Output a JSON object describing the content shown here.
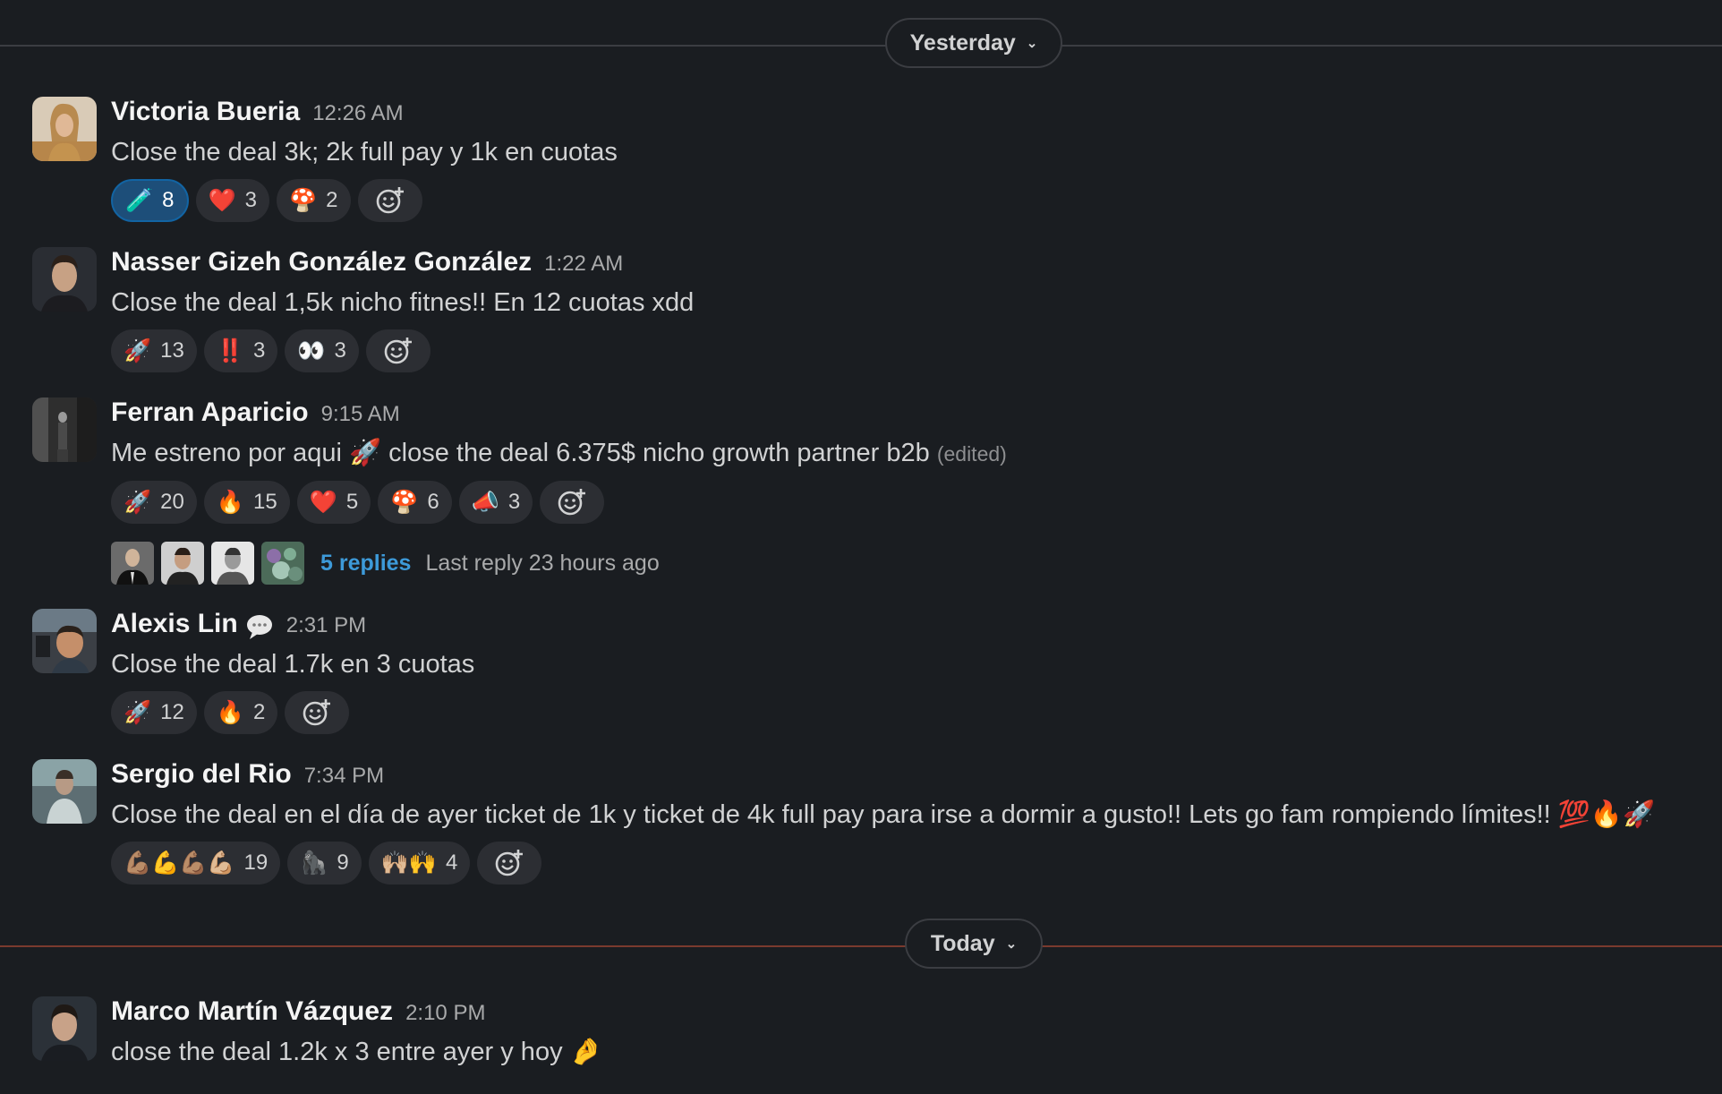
{
  "colors": {
    "background": "#1a1d21",
    "divider_yesterday": "#3b3d42",
    "divider_today": "#7a3a2e",
    "link": "#3d9ad9",
    "active_reaction_bg": "#1d4e79"
  },
  "dividers": {
    "yesterday": {
      "label": "Yesterday"
    },
    "today": {
      "label": "Today"
    }
  },
  "messages": [
    {
      "name": "Victoria Bueria",
      "time": "12:26 AM",
      "text": "Close the deal 3k; 2k full pay y 1k en cuotas",
      "reactions": [
        {
          "emoji": "🧪",
          "icon": "test-tube-icon",
          "count": "8",
          "active": true
        },
        {
          "emoji": "❤️",
          "icon": "heart-icon",
          "count": "3"
        },
        {
          "emoji": "🍄",
          "icon": "mushroom-icon",
          "count": "2"
        }
      ]
    },
    {
      "name": "Nasser Gizeh González González",
      "time": "1:22 AM",
      "text": "Close the deal 1,5k nicho fitnes!! En 12 cuotas xdd",
      "reactions": [
        {
          "emoji": "🚀",
          "icon": "rocket-icon",
          "count": "13"
        },
        {
          "emoji": "‼️",
          "icon": "double-exclamation-icon",
          "count": "3"
        },
        {
          "emoji": "👀",
          "icon": "eyes-icon",
          "count": "3"
        }
      ]
    },
    {
      "name": "Ferran Aparicio",
      "time": "9:15 AM",
      "text_before": "Me estreno por aqui",
      "text_emoji": "🚀",
      "text_after": "close the deal 6.375$ nicho growth partner b2b",
      "edited": "(edited)",
      "reactions": [
        {
          "emoji": "🚀",
          "icon": "rocket-icon",
          "count": "20"
        },
        {
          "emoji": "🔥",
          "icon": "fire-icon",
          "count": "15"
        },
        {
          "emoji": "❤️",
          "icon": "heart-icon",
          "count": "5"
        },
        {
          "emoji": "🍄",
          "icon": "mushroom-icon",
          "count": "6"
        },
        {
          "emoji": "📣",
          "icon": "megaphone-icon",
          "count": "3"
        }
      ],
      "thread": {
        "replies": "5 replies",
        "last_reply": "Last reply 23 hours ago"
      }
    },
    {
      "name": "Alexis Lin",
      "time": "2:31 PM",
      "status_icon": "speech-bubble-icon",
      "text": "Close the deal 1.7k en 3 cuotas",
      "reactions": [
        {
          "emoji": "🚀",
          "icon": "rocket-icon",
          "count": "12"
        },
        {
          "emoji": "🔥",
          "icon": "fire-icon",
          "count": "2"
        }
      ]
    },
    {
      "name": "Sergio del Rio",
      "time": "7:34 PM",
      "text": "Close the deal en el día de ayer ticket de 1k y ticket de 4k full pay para irse a dormir a gusto!! Lets go fam rompiendo límites!! 💯🔥🚀",
      "reactions": [
        {
          "emoji": "💪🏽💪💪🏽💪🏼",
          "icon": "flexed-biceps-icon",
          "count": "19"
        },
        {
          "emoji": "🦍",
          "icon": "gorilla-icon",
          "count": "9"
        },
        {
          "emoji": "🙌🏼🙌",
          "icon": "raised-hands-icon",
          "count": "4"
        }
      ]
    },
    {
      "name": "Marco Martín Vázquez",
      "time": "2:10 PM",
      "text": "close the deal 1.2k x 3 entre ayer y hoy 🤌"
    }
  ]
}
